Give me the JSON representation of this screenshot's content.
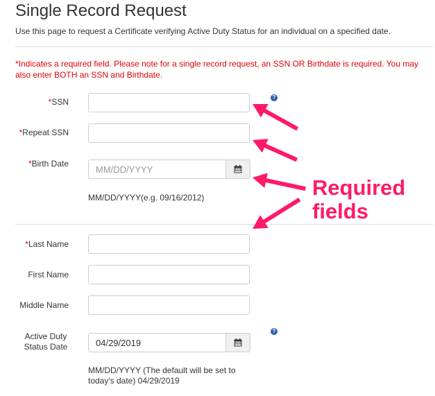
{
  "header": {
    "title": "Single Record Request",
    "intro": "Use this page to request a Certificate verifying Active Duty Status for an individual on a specified date."
  },
  "notice": {
    "text": "*Indicates a required field. Please note for a single record request, an SSN OR Birthdate is required. You may also enter BOTH an SSN and Birthdate."
  },
  "form": {
    "ssn": {
      "label": "SSN",
      "required": "*",
      "value": ""
    },
    "repeat_ssn": {
      "label": "Repeat SSN",
      "required": "*",
      "value": ""
    },
    "birth_date": {
      "label": "Birth Date",
      "required": "*",
      "value": "",
      "placeholder": "MM/DD/YYYY",
      "hint": "MM/DD/YYYY(e.g. 09/16/2012)"
    },
    "last_name": {
      "label": "Last Name",
      "required": "*",
      "value": ""
    },
    "first_name": {
      "label": "First Name",
      "value": ""
    },
    "middle_name": {
      "label": "Middle Name",
      "value": ""
    },
    "active_duty_date": {
      "label": "Active Duty Status Date",
      "value": "04/29/2019",
      "hint": "MM/DD/YYYY (The default will be set to today's date) 04/29/2019"
    },
    "help_glyph": "?"
  },
  "annotation": {
    "line1": "Required",
    "line2": "fields",
    "color": "#ff1a68"
  },
  "icons": {
    "calendar": "calendar-icon",
    "help": "question-circle-icon",
    "arrow": "annotation-arrow"
  },
  "colors": {
    "required": "#e00000",
    "help_icon": "#2a5fa6",
    "annotation": "#ff1a68"
  }
}
